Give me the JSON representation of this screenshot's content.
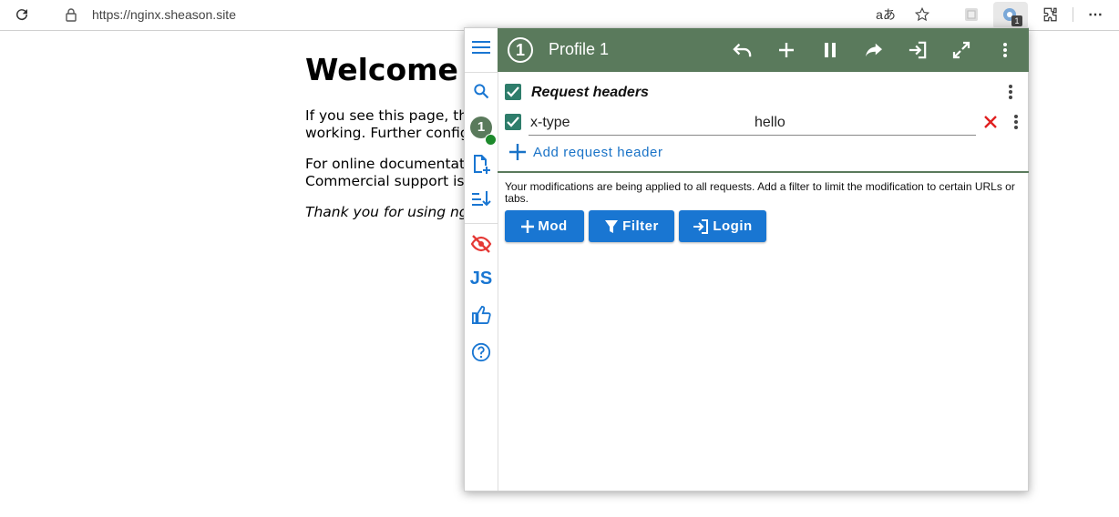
{
  "browser": {
    "url": "https://nginx.sheason.site",
    "read_aloud_label": "aあ",
    "extension_badge": "1"
  },
  "page": {
    "heading": "Welcome to",
    "para1_line1": "If you see this page, the",
    "para1_line2": "working. Further configu",
    "para2_line1": "For online documentation",
    "para2_line2": "Commercial support is av",
    "para3": "Thank you for using ngin"
  },
  "popup": {
    "profile_number": "1",
    "profile_name": "Profile 1",
    "section_title": "Request headers",
    "header_row": {
      "name": "x-type",
      "value": "hello"
    },
    "add_header_label": "Add request header",
    "note": "Your modifications are being applied to all requests. Add a filter to limit the modification to certain URLs or tabs.",
    "buttons": {
      "mod": "Mod",
      "filter": "Filter",
      "login": "Login"
    },
    "sidebar_profile_number": "1",
    "js_label": "JS"
  },
  "colors": {
    "header_green": "#5a7a5c",
    "accent_blue": "#1976d2",
    "checkbox_teal": "#2e7d6b",
    "delete_red": "#e02020"
  }
}
